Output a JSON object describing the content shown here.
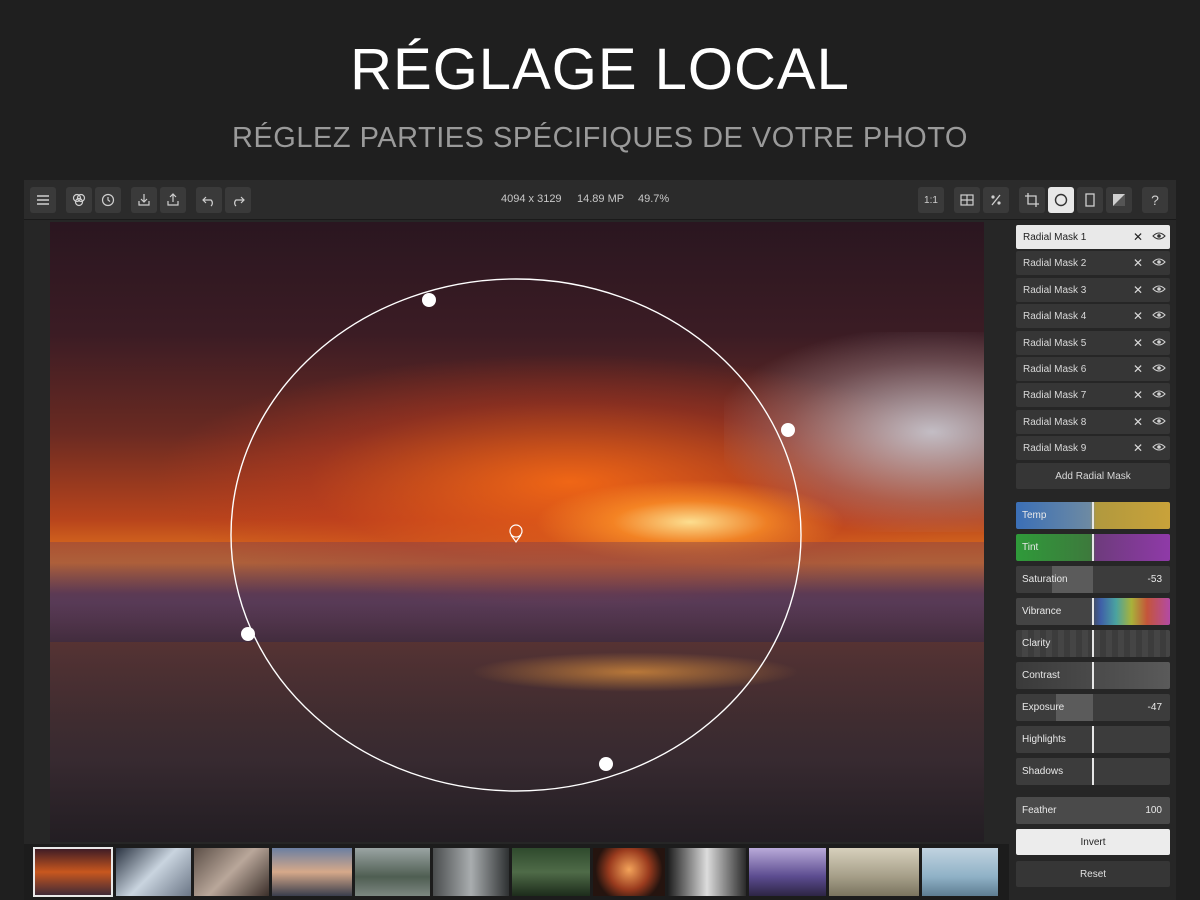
{
  "hero": {
    "title": "RÉGLAGE LOCAL",
    "subtitle": "RÉGLEZ PARTIES SPÉCIFIQUES DE VOTRE PHOTO"
  },
  "toolbar": {
    "dimensions": "4094 x 3129",
    "megapixels": "14.89 MP",
    "zoom": "49.7%",
    "icons": [
      "menu-icon",
      "filters-icon",
      "history-icon",
      "import-icon",
      "export-icon",
      "undo-icon",
      "redo-icon",
      "actual-size-icon",
      "compare-icon",
      "percent-icon",
      "crop-icon",
      "radial-mask-icon",
      "vignette-icon",
      "gradient-mask-icon",
      "help-icon"
    ],
    "actual_size_label": "1:1",
    "help_label": "?"
  },
  "masks": {
    "items": [
      {
        "label": "Radial Mask 1",
        "selected": true
      },
      {
        "label": "Radial Mask 2"
      },
      {
        "label": "Radial Mask 3"
      },
      {
        "label": "Radial Mask 4"
      },
      {
        "label": "Radial Mask 5"
      },
      {
        "label": "Radial Mask 6"
      },
      {
        "label": "Radial Mask 7"
      },
      {
        "label": "Radial Mask 8"
      },
      {
        "label": "Radial Mask 9"
      }
    ],
    "delete_symbol": "✕",
    "add_label": "Add Radial Mask"
  },
  "adjustments": {
    "temp": {
      "label": "Temp",
      "value": ""
    },
    "tint": {
      "label": "Tint",
      "value": ""
    },
    "saturation": {
      "label": "Saturation",
      "value": "-53"
    },
    "vibrance": {
      "label": "Vibrance",
      "value": ""
    },
    "clarity": {
      "label": "Clarity",
      "value": ""
    },
    "contrast": {
      "label": "Contrast",
      "value": ""
    },
    "exposure": {
      "label": "Exposure",
      "value": "-47"
    },
    "highlights": {
      "label": "Highlights",
      "value": ""
    },
    "shadows": {
      "label": "Shadows",
      "value": ""
    },
    "feather": {
      "label": "Feather",
      "value": "100"
    }
  },
  "actions": {
    "invert": "Invert",
    "reset": "Reset"
  },
  "colors": {
    "accent_temp_blue": "#3b6fb6",
    "accent_temp_yellow": "#c9a23a",
    "tint_green": "#2f9a3a",
    "tint_purple": "#8f3aa8"
  },
  "filmstrip": {
    "count": 12,
    "selected_index": 0
  }
}
